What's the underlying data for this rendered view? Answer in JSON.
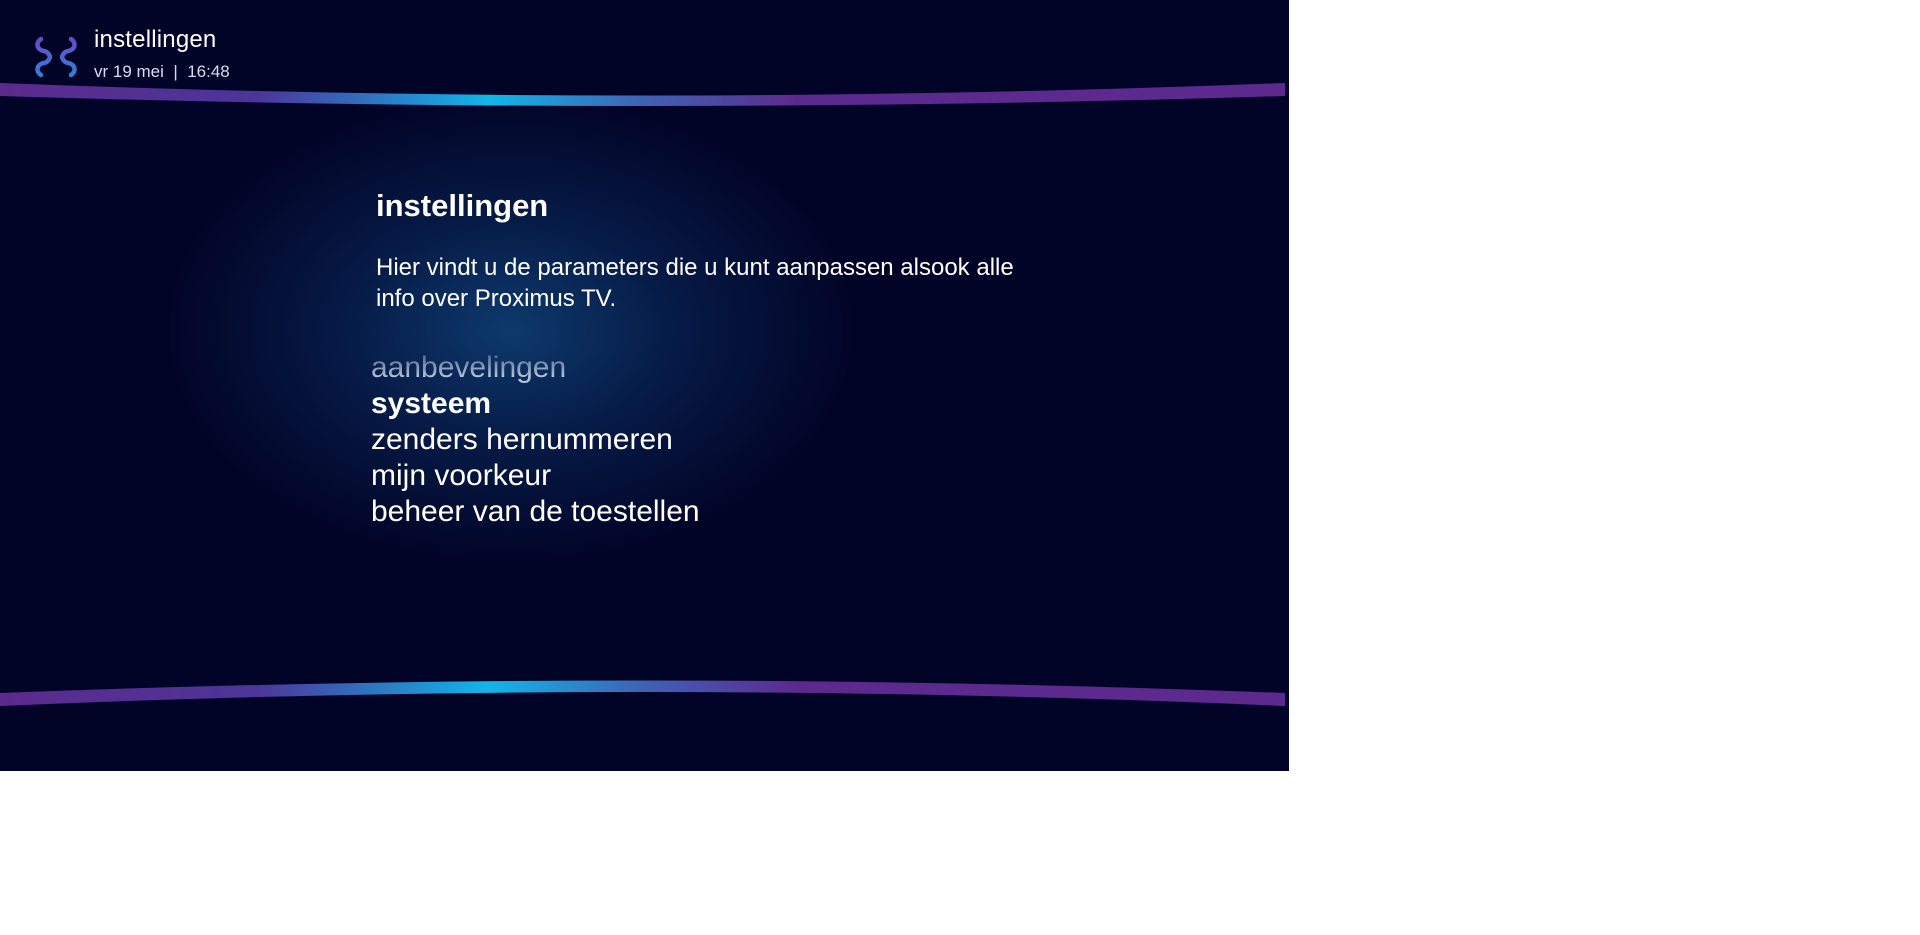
{
  "header": {
    "title": "instellingen",
    "meta": "vr 19 mei  |  16:48",
    "logo": "proximus-logo-icon"
  },
  "panel": {
    "title": "instellingen",
    "description": "Hier vindt u de parameters die u kunt aanpassen alsook alle info over Proximus TV."
  },
  "menu": {
    "items": [
      {
        "label": "aanbevelingen",
        "state": "faded"
      },
      {
        "label": "systeem",
        "state": "selected"
      },
      {
        "label": "zenders hernummeren",
        "state": "normal"
      },
      {
        "label": "mijn voorkeur",
        "state": "normal"
      },
      {
        "label": "beheer van de toestellen",
        "state": "normal"
      }
    ]
  },
  "colors": {
    "background": "#020427",
    "accent_purple": "#5c2a8e",
    "accent_cyan": "#11b6e9",
    "glow": "#0e3c70",
    "text": "#ffffff"
  }
}
